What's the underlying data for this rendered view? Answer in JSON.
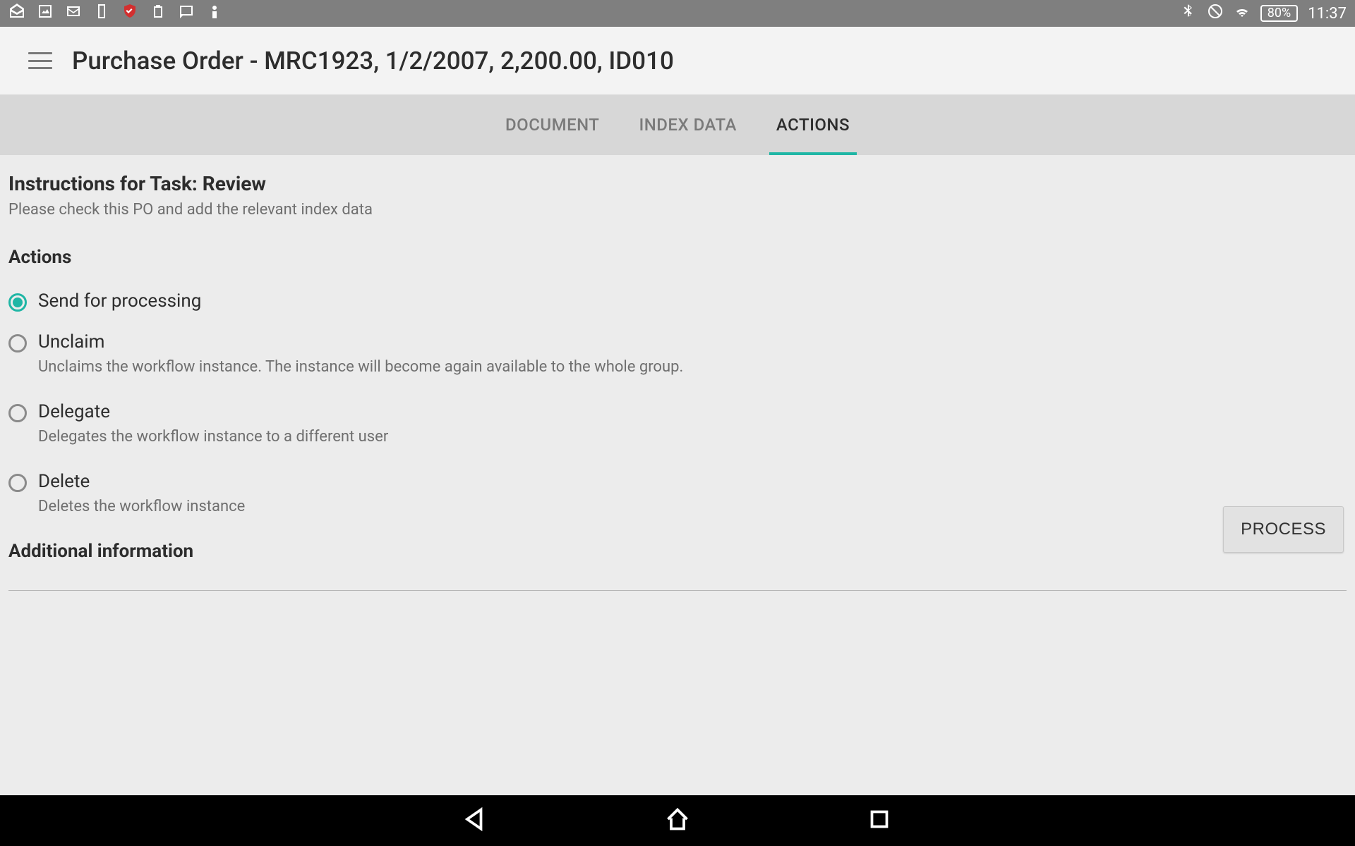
{
  "status_bar": {
    "battery": "80%",
    "time": "11:37"
  },
  "app_bar": {
    "title": "Purchase Order - MRC1923, 1/2/2007, 2,200.00, ID010"
  },
  "tabs": {
    "document": "DOCUMENT",
    "index_data": "INDEX DATA",
    "actions": "ACTIONS"
  },
  "instructions": {
    "title": "Instructions for Task: Review",
    "description": "Please check this PO and add the relevant index data"
  },
  "actions_section": {
    "heading": "Actions",
    "options": {
      "send": {
        "label": "Send for processing"
      },
      "unclaim": {
        "label": "Unclaim",
        "desc": "Unclaims the workflow instance. The instance will become again available to the whole group."
      },
      "delegate": {
        "label": "Delegate",
        "desc": "Delegates the workflow instance to a different user"
      },
      "delete": {
        "label": "Delete",
        "desc": "Deletes the workflow instance"
      }
    }
  },
  "additional_info": {
    "heading": "Additional information"
  },
  "process_button": "PROCESS"
}
